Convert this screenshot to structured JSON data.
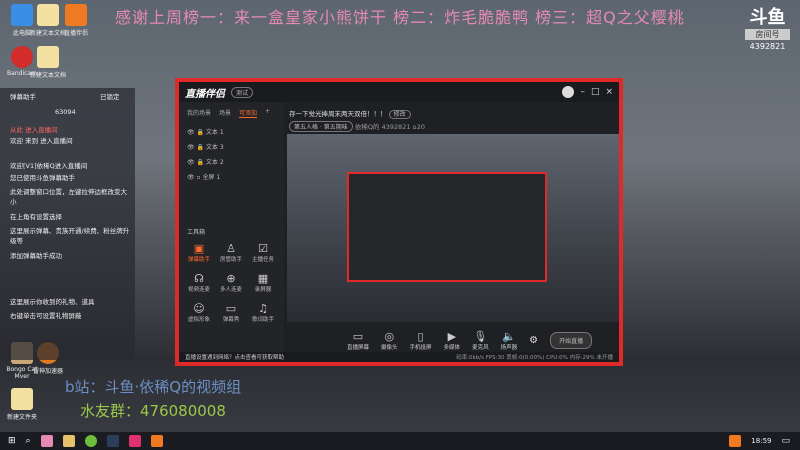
{
  "banner": "感谢上周榜一：来一盒皇家小熊饼干 榜二：炸毛脆脆鸭 榜三：超Q之父樱桃",
  "platform_logo": {
    "mark": "斗鱼",
    "label": "房间号",
    "room_id": "4392821"
  },
  "desktop_icons": [
    "此电脑",
    "新建文本文档",
    "直播伴侣",
    "Bandicam",
    "新建文本文档",
    "雷神加速器",
    "Bongo Cat Mver",
    "雷神加速器",
    "新建文件夹"
  ],
  "chat": {
    "header": "弹幕助手",
    "lock_label": "已锁定",
    "fans": "63094",
    "lines": [
      "从此 进入直播间",
      "欢迎 来到 进入直播间",
      "欢迎[V1]依稀Q进入直播间",
      "您已使用斗鱼弹幕助手",
      "此处调整窗口位置，左键拉伸边框改变大小",
      "在上角有设置选择",
      "这里展示弹幕、贵族开通/续费、粉丝牌升级等",
      "添加弹幕助手成功",
      "这里展示你收到的礼物、道具",
      "右键单击可设置礼物屏蔽"
    ]
  },
  "app": {
    "brand": "直播伴侣",
    "version": "测试",
    "tabs": [
      "我的场景",
      "场景",
      "可添加"
    ],
    "sources": [
      "文本 1",
      "文本 3",
      "文本 2",
      "全屏 1"
    ],
    "toolbox_title": "工具箱",
    "tools": [
      "弹幕助手",
      "房管助手",
      "主播任务",
      "视频连麦",
      "多人连麦",
      "录屏器",
      "虚拟形象",
      "弹幕秀",
      "歌词助手"
    ],
    "stream_title": "存一下觉光捧周末两天双倍！！！",
    "edit_label": "修改",
    "category": "第五人格 · 第五期味",
    "streamer": "依稀Q的",
    "room_id": "4392821",
    "heat": "20",
    "bottom_buttons": [
      "直播屏幕",
      "摄像头",
      "手机投屏",
      "多媒体",
      "麦克风",
      "扬声器"
    ],
    "start_label": "开始直播",
    "notice": "直播设置遇到网络？点击查看可获取帮助",
    "stats": [
      "码率:0kb/s",
      "FPS:30",
      "丢帧:0(0.00%)",
      "CPU:0%",
      "内存:29%",
      "未开播"
    ]
  },
  "overlay": {
    "bilibili": "b站：斗鱼·依稀Q的视频组",
    "fan_group": "水友群：476080008"
  },
  "taskbar": {
    "time": "18:59"
  }
}
